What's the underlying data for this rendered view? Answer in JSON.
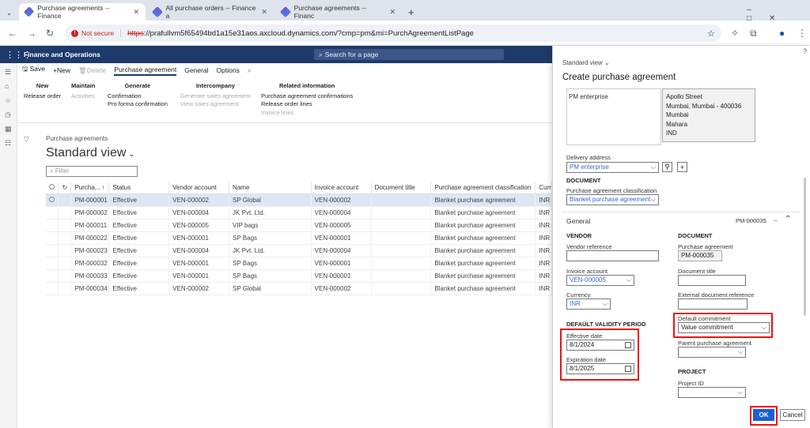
{
  "browser": {
    "tabs": [
      {
        "label": "Purchase agreements -- Finance"
      },
      {
        "label": "All purchase orders -- Finance a"
      },
      {
        "label": "Purchase agreements -- Financ"
      }
    ],
    "not_secure": "Not secure",
    "url_scheme": "https",
    "url_rest": "://prafullvm5f65494bd1a15e31aos.axcloud.dynamics.com/?cmp=pm&mi=PurchAgreementListPage"
  },
  "app": {
    "title": "Finance and Operations",
    "search_placeholder": "Search for a page"
  },
  "actionbar": {
    "save": "Save",
    "new": "New",
    "delete": "Delete",
    "tab_purchase_agreement": "Purchase agreement",
    "tab_general": "General",
    "tab_options": "Options"
  },
  "ribbon": {
    "new_header": "New",
    "release_order": "Release order",
    "maintain_header": "Maintain",
    "activities": "Activities",
    "generate_header": "Generate",
    "confirmation": "Confirmation",
    "pro_forma": "Pro forma confirmation",
    "intercompany_header": "Intercompany",
    "generate_sales": "Generate sales agreement",
    "view_sales": "View sales agreement",
    "related_header": "Related information",
    "pa_confirmations": "Purchase agreement confirmations",
    "release_order_lines": "Release order lines",
    "invoice_lines": "Invoice lines"
  },
  "list": {
    "breadcrumb": "Purchase agreements",
    "view_title": "Standard view",
    "filter_placeholder": "Filter",
    "columns": [
      "Purcha...",
      "Status",
      "Vendor account",
      "Name",
      "Invoice account",
      "Document title",
      "Purchase agreement classification",
      "Curr"
    ],
    "rows": [
      {
        "id": "PM-000001",
        "status": "Effective",
        "vendor": "VEN-000002",
        "name": "SP Global",
        "invoice": "VEN-000002",
        "doc": "",
        "class": "Blanket purchase agreement",
        "cur": "INR"
      },
      {
        "id": "PM-000002",
        "status": "Effective",
        "vendor": "VEN-000004",
        "name": "JK Pvt. Ltd.",
        "invoice": "VEN-000004",
        "doc": "",
        "class": "Blanket purchase agreement",
        "cur": "INR"
      },
      {
        "id": "PM-000011",
        "status": "Effective",
        "vendor": "VEN-000005",
        "name": "VIP bags",
        "invoice": "VEN-000005",
        "doc": "",
        "class": "Blanket purchase agreement",
        "cur": "INR"
      },
      {
        "id": "PM-000022",
        "status": "Effective",
        "vendor": "VEN-000001",
        "name": "SP Bags",
        "invoice": "VEN-000001",
        "doc": "",
        "class": "Blanket purchase agreement",
        "cur": "INR"
      },
      {
        "id": "PM-000023",
        "status": "Effective",
        "vendor": "VEN-000004",
        "name": "JK Pvt. Ltd.",
        "invoice": "VEN-000004",
        "doc": "",
        "class": "Blanket purchase agreement",
        "cur": "INR"
      },
      {
        "id": "PM-000032",
        "status": "Effective",
        "vendor": "VEN-000001",
        "name": "SP Bags",
        "invoice": "VEN-000001",
        "doc": "",
        "class": "Blanket purchase agreement",
        "cur": "INR"
      },
      {
        "id": "PM-000033",
        "status": "Effective",
        "vendor": "VEN-000001",
        "name": "SP Bags",
        "invoice": "VEN-000001",
        "doc": "",
        "class": "Blanket purchase agreement",
        "cur": "INR"
      },
      {
        "id": "PM-000034",
        "status": "Effective",
        "vendor": "VEN-000002",
        "name": "SP Global",
        "invoice": "VEN-000002",
        "doc": "",
        "class": "Blanket purchase agreement",
        "cur": "INR"
      }
    ]
  },
  "dialog": {
    "view_name": "Standard view",
    "title": "Create purchase agreement",
    "site_name": "PM enterprise",
    "address_lines": [
      "Apollo Street",
      "Mumbai, Mumbai - 400036",
      "Mumbai",
      "Mahara",
      "IND"
    ],
    "delivery_address_label": "Delivery address",
    "delivery_address_value": "PM enterprise",
    "document_section": "DOCUMENT",
    "classification_label": "Purchase agreement classification",
    "classification_value": "Blanket purchase agreement",
    "general_label": "General",
    "general_summary": "PM-000035",
    "general_more": "--",
    "vendor_section": "VENDOR",
    "vendor_reference_label": "Vendor reference",
    "vendor_reference_value": "",
    "invoice_account_label": "Invoice account",
    "invoice_account_value": "VEN-000005",
    "currency_label": "Currency",
    "currency_value": "INR",
    "validity_section": "DEFAULT VALIDITY PERIOD",
    "effective_date_label": "Effective date",
    "effective_date_value": "8/1/2024",
    "expiration_date_label": "Expiration date",
    "expiration_date_value": "8/1/2025",
    "document_section2": "DOCUMENT",
    "purchase_agreement_label": "Purchase agreement",
    "purchase_agreement_value": "PM-000035",
    "document_title_label": "Document title",
    "document_title_value": "",
    "external_ref_label": "External document reference",
    "external_ref_value": "",
    "default_commitment_label": "Default commitment",
    "default_commitment_value": "Value commitment",
    "parent_label": "Parent purchase agreement",
    "parent_value": "",
    "project_section": "PROJECT",
    "project_id_label": "Project ID",
    "project_id_value": "",
    "ok": "OK",
    "cancel": "Cancel",
    "help": "?"
  }
}
